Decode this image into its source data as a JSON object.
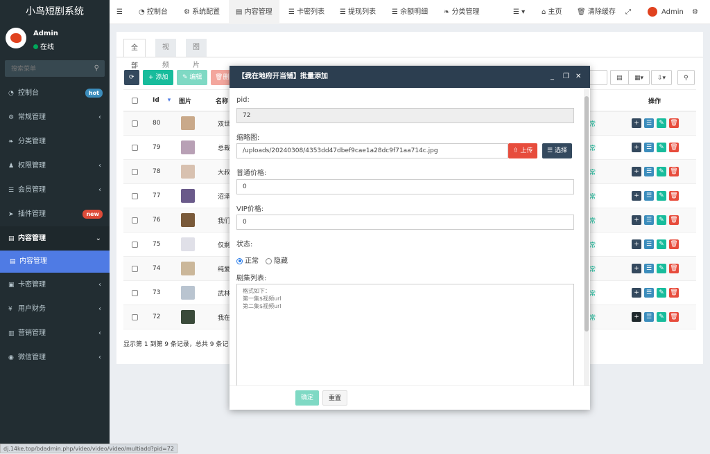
{
  "app": {
    "title": "小鸟短剧系统"
  },
  "user": {
    "name": "Admin",
    "status": "在线"
  },
  "search": {
    "placeholder": "搜索菜单"
  },
  "sidebar": {
    "items": [
      {
        "label": "控制台",
        "badge": "hot",
        "badge_color": "#3c8dbc"
      },
      {
        "label": "常规管理",
        "arrow": "‹"
      },
      {
        "label": "分类管理"
      },
      {
        "label": "权限管理",
        "arrow": "‹"
      },
      {
        "label": "会员管理",
        "arrow": "‹"
      },
      {
        "label": "插件管理",
        "badge": "new",
        "badge_color": "#dd4b39"
      },
      {
        "label": "内容管理",
        "arrow": "⌄"
      },
      {
        "label": "内容管理"
      },
      {
        "label": "卡密管理",
        "arrow": "‹"
      },
      {
        "label": "用户财务",
        "arrow": "‹"
      },
      {
        "label": "营销管理",
        "arrow": "‹"
      },
      {
        "label": "微信管理",
        "arrow": "‹"
      }
    ]
  },
  "topnav": {
    "items": [
      "控制台",
      "系统配置",
      "内容管理",
      "卡密列表",
      "提现列表",
      "余额明细",
      "分类管理"
    ],
    "right": {
      "home": "主页",
      "clear_cache": "清除缓存",
      "admin": "Admin"
    }
  },
  "tabs": [
    "全部",
    "视频",
    "图片"
  ],
  "toolbar": {
    "add": "添加",
    "edit": "编辑",
    "delete": "删"
  },
  "table": {
    "headers": {
      "id": "Id",
      "image": "图片",
      "name": "名称",
      "ops": "操作"
    },
    "rows": [
      {
        "id": "80",
        "name": "双世",
        "status": "常"
      },
      {
        "id": "79",
        "name": "总裁",
        "status": "常"
      },
      {
        "id": "78",
        "name": "大叔",
        "status": "常"
      },
      {
        "id": "77",
        "name": "沼泽",
        "status": "常"
      },
      {
        "id": "76",
        "name": "我们",
        "status": "常"
      },
      {
        "id": "75",
        "name": "仅剩",
        "status": "常"
      },
      {
        "id": "74",
        "name": "纯爱",
        "status": "常"
      },
      {
        "id": "73",
        "name": "武林",
        "status": "常"
      },
      {
        "id": "72",
        "name": "我在",
        "status": "常"
      }
    ],
    "footer": "显示第 1 到第 9 条记录，总共 9 条记"
  },
  "modal": {
    "title": "【我在地府开当铺】批量添加",
    "pid_label": "pid:",
    "pid_value": "72",
    "thumb_label": "缩略图:",
    "thumb_value": "/uploads/20240308/4353dd47dbef9cae1a28dc9f71aa714c.jpg",
    "upload_btn": "上传",
    "select_btn": "选择",
    "price_label": "普通价格:",
    "price_value": "0",
    "vip_label": "VIP价格:",
    "vip_value": "0",
    "status_label": "状态:",
    "status_normal": "正常",
    "status_hidden": "隐藏",
    "episodes_label": "剧集列表:",
    "episodes_placeholder": "格式如下：\n第一集$视频url\n第二集$视频url",
    "confirm": "确定",
    "reset": "重置"
  },
  "statusbar": {
    "url": "dj.14ke.top/bdadmin.php/video/video/video/multiadd?pid=72"
  },
  "colors": {
    "sidebar": "#222d32",
    "accent": "#4f7be4",
    "success": "#1abc9c",
    "danger": "#e74c3c",
    "dark": "#34495e"
  }
}
